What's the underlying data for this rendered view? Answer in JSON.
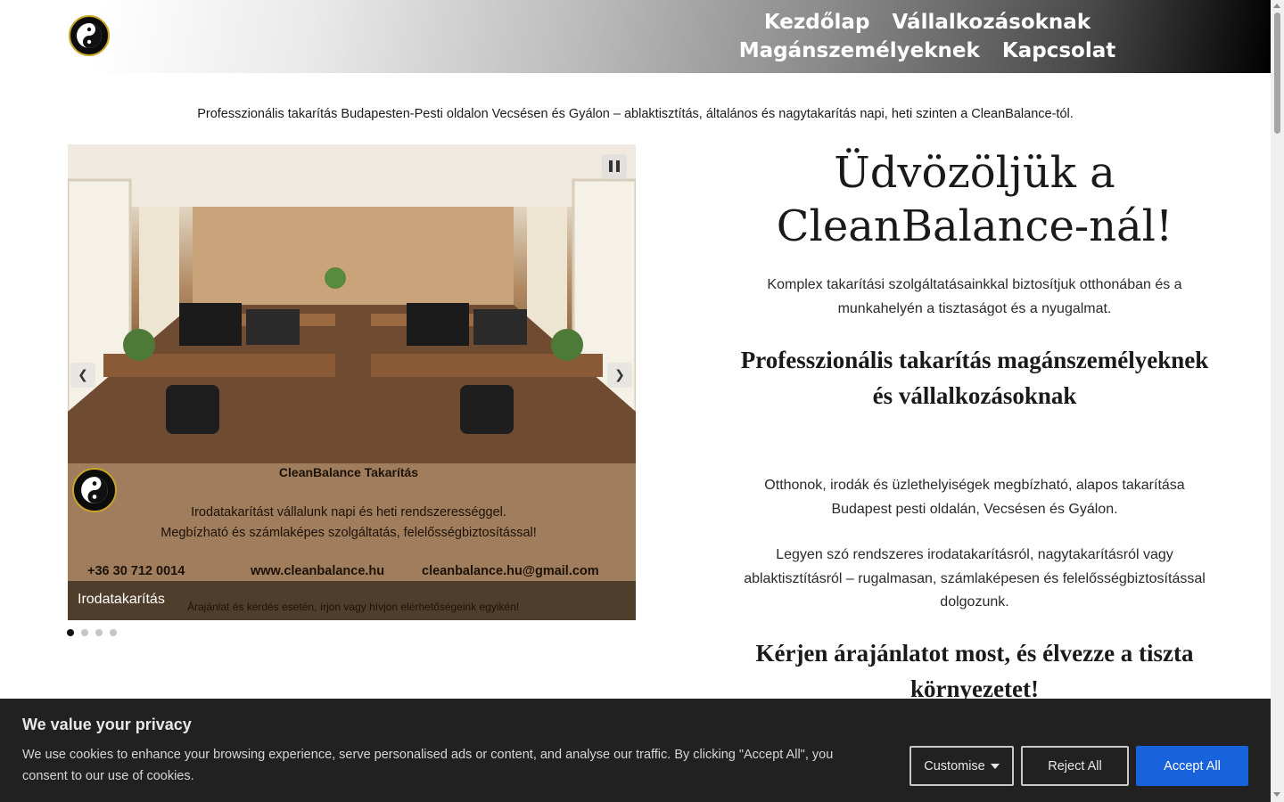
{
  "nav": {
    "items": [
      {
        "label": "Kezdőlap"
      },
      {
        "label": "Vállalkozásoknak"
      },
      {
        "label": "Magánszemélyeknek"
      },
      {
        "label": "Kapcsolat"
      }
    ]
  },
  "tagline": "Professzionális takarítás Budapesten-Pesti oldalon Vecsésen és Gyálon – ablaktisztítás, általános és nagytakarítás napi, heti szinten a CleanBalance-tól.",
  "slider": {
    "slide_title": "CleanBalance Takarítás",
    "slide_line1": "Irodatakarítást vállalunk napi és heti rendszerességgel.",
    "slide_line2": "Megbízható és számlaképes szolgáltatás, felelősségbiztosítással!",
    "phone": "+36 30 712 0014",
    "website": "www.cleanbalance.hu",
    "email": "cleanbalance.hu@gmail.com",
    "caption": "Irodatakarítás",
    "caption_sub": "Árajánlat és kérdés esetén, írjon vagy hívjon elérhetőségeink egyikén!",
    "dots_count": 4,
    "active_dot": 0
  },
  "content": {
    "welcome": "Üdvözöljük a CleanBalance-nál!",
    "intro": "Komplex takarítási szolgáltatásainkkal biztosítjuk otthonában és a munkahelyén a tisztaságot és a nyugalmat.",
    "heading2": "Professzionális takarítás magánszemélyeknek és vállalkozásoknak",
    "para2": "Otthonok, irodák és üzlethelyiségek megbízható, alapos takarítása Budapest pesti oldalán, Vecsésen és Gyálon.",
    "para3": "Legyen szó rendszeres irodatakarításról, nagytakarításról vagy ablaktisztításról – rugalmasan, számlaképesen és felelősségbiztosítással dolgozunk.",
    "heading3": "Kérjen árajánlatot most, és élvezze a tiszta környezetet!"
  },
  "cookie": {
    "title": "We value your privacy",
    "text": "We use cookies to enhance your browsing experience, serve personalised ads or content, and analyse our traffic. By clicking \"Accept All\", you consent to our use of cookies.",
    "customise_label": "Customise",
    "reject_label": "Reject All",
    "accept_label": "Accept All"
  },
  "colors": {
    "accent": "#1863dc",
    "banner_bg": "#212121"
  },
  "icons": {
    "logo": "yin-yang-logo-icon",
    "prev": "chevron-left-icon",
    "next": "chevron-right-icon",
    "pause": "pause-icon",
    "dropdown": "caret-down-icon"
  }
}
